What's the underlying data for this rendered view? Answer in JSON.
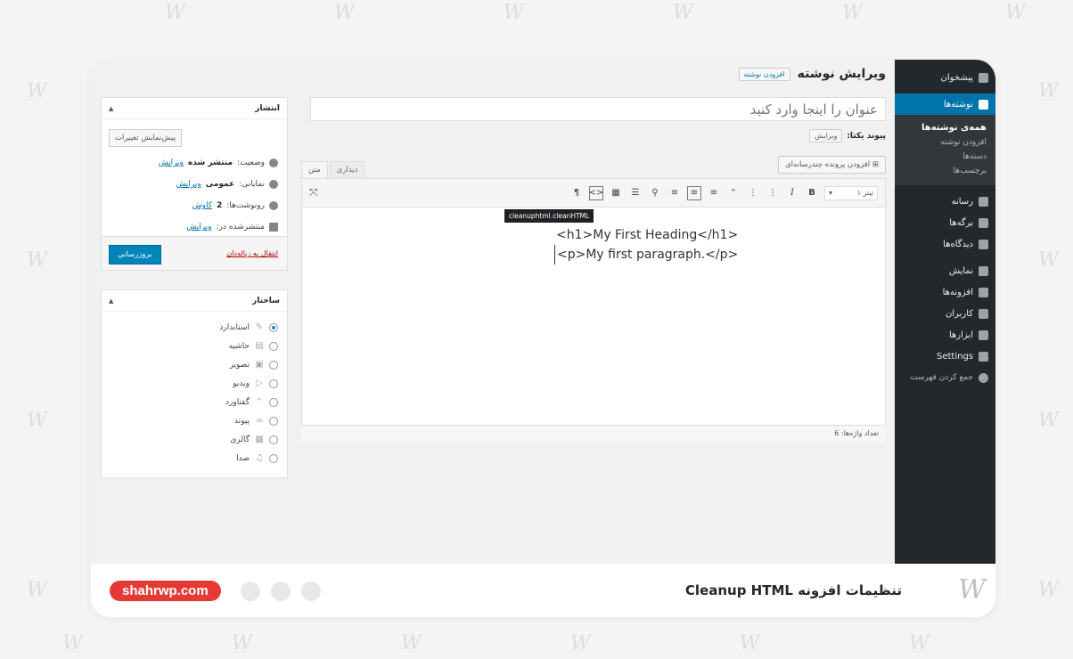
{
  "admin_menu": {
    "dashboard": "پیشخوان",
    "posts": "نوشته‌ها",
    "posts_sub": [
      "همه‌ی نوشته‌ها",
      "افزودن نوشته",
      "دسته‌ها",
      "برچسب‌ها"
    ],
    "media": "رسانه",
    "pages": "برگه‌ها",
    "comments": "دیدگاه‌ها",
    "appearance": "نمایش",
    "plugins": "افزونه‌ها",
    "users": "کاربران",
    "tools": "ابزارها",
    "settings": "Settings",
    "collapse": "جمع کردن فهرست"
  },
  "header": {
    "title": "ویرایش نوشته",
    "add_new": "افزودن نوشته"
  },
  "title_input": {
    "placeholder": "عنوان را اینجا وارد کنید"
  },
  "permalink": {
    "label": "پیوند یکتا:",
    "edit": "ویرایش"
  },
  "media_button": "افزودن پرونده چندرسانه‌ای",
  "tabs": {
    "visual": "دیداری",
    "text": "متن"
  },
  "toolbar": {
    "format": "تیتر ۱",
    "tooltip": "cleanuphtml.cleanHTML"
  },
  "content": {
    "line1": "<h1>My First Heading</h1>",
    "line2": "<p>My first paragraph.</p>"
  },
  "word_count": "تعداد واژه‌ها: 6",
  "publish_box": {
    "title": "انتشار",
    "preview": "پیش‌نمایش تغییرات",
    "status_label": "وضعیت:",
    "status_value": "منتشر شده",
    "visibility_label": "نمایانی:",
    "visibility_value": "عمومی",
    "revisions_label": "رونوشت‌ها:",
    "revisions_value": "2",
    "revisions_link": "کاوش",
    "published_label": "منتشرشده در:",
    "edit": "ویرایش",
    "trash": "انتقال به زباله‌دان",
    "update": "بروزرسانی"
  },
  "format_box": {
    "title": "ساختار",
    "options": [
      "استاندارد",
      "حاشیه",
      "تصویر",
      "ویدیو",
      "گفتاورد",
      "پیوند",
      "گالری",
      "صدا"
    ]
  },
  "footer": {
    "site": "shahrwp.com",
    "title": "تنظیمات افزونه Cleanup HTML"
  }
}
